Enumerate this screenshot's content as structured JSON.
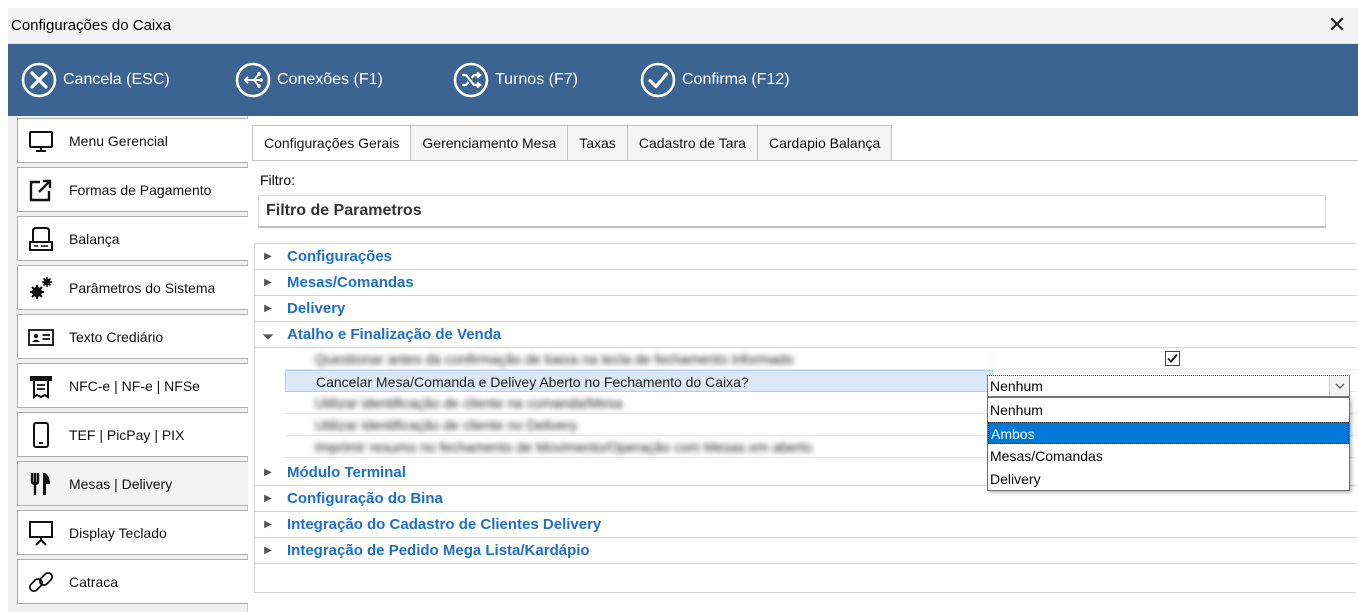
{
  "window": {
    "title": "Configurações do Caixa",
    "close_glyph": "✕"
  },
  "toolbar": {
    "cancel": {
      "label": "Cancela (ESC)",
      "icon": "cancel-circle-icon"
    },
    "connections": {
      "label": "Conexões (F1)",
      "icon": "connections-icon"
    },
    "shifts": {
      "label": "Turnos (F7)",
      "icon": "shuffle-icon"
    },
    "confirm": {
      "label": "Confirma (F12)",
      "icon": "check-circle-icon"
    }
  },
  "sidebar": {
    "items": [
      {
        "label": "Menu Gerencial",
        "icon": "monitor-icon"
      },
      {
        "label": "Formas de Pagamento",
        "icon": "external-link-icon"
      },
      {
        "label": "Balança",
        "icon": "scale-icon"
      },
      {
        "label": "Parâmetros do Sistema",
        "icon": "gears-icon"
      },
      {
        "label": "Texto Crediário",
        "icon": "id-card-icon"
      },
      {
        "label": "NFC-e | NF-e | NFSe",
        "icon": "receipt-printer-icon"
      },
      {
        "label": "TEF | PicPay | PIX",
        "icon": "smartphone-icon"
      },
      {
        "label": "Mesas | Delivery",
        "icon": "fork-knife-icon"
      },
      {
        "label": "Display Teclado",
        "icon": "presentation-display-icon"
      },
      {
        "label": "Catraca",
        "icon": "chain-link-icon"
      }
    ]
  },
  "tabs": [
    {
      "label": "Configurações Gerais",
      "active": true
    },
    {
      "label": "Gerenciamento Mesa",
      "active": false
    },
    {
      "label": "Taxas",
      "active": false
    },
    {
      "label": "Cadastro de Tara",
      "active": false
    },
    {
      "label": "Cardapio Balança",
      "active": false
    }
  ],
  "filter": {
    "label": "Filtro:",
    "placeholder": "Filtro de Parametros"
  },
  "groups": [
    {
      "name": "Configurações",
      "expanded": false
    },
    {
      "name": "Mesas/Comandas",
      "expanded": false
    },
    {
      "name": "Delivery",
      "expanded": false
    },
    {
      "name": "Atalho e Finalização de Venda",
      "expanded": true
    },
    {
      "name": "Módulo Terminal",
      "expanded": false
    },
    {
      "name": "Configuração do Bina",
      "expanded": false
    },
    {
      "name": "Integração do Cadastro de Clientes Delivery",
      "expanded": false
    },
    {
      "name": "Integração de Pedido Mega Lista/Kardápio",
      "expanded": false
    }
  ],
  "params": {
    "blurred_1": "Questionar antes da confirmação de baixa na tecla de fechamento informado",
    "selected": "Cancelar Mesa/Comanda e Delivey Aberto no Fechamento do Caixa?",
    "blurred_2": "Utilizar identificação de cliente na comanda/Mesa",
    "blurred_3": "Utilizar identificação de cliente no Delivery",
    "blurred_4": "Imprimir resumo no fechamento de Movimento/Operação com Mesas em aberto"
  },
  "checkbox": {
    "checked": true
  },
  "combo": {
    "value": "Nenhum",
    "options": [
      "Nenhum",
      "Ambos",
      "Mesas/Comandas",
      "Delivery"
    ],
    "highlighted": "Ambos"
  },
  "colors": {
    "toolbar": "#3c6493",
    "group_text": "#1e6fc5",
    "highlight": "#0078d7"
  }
}
